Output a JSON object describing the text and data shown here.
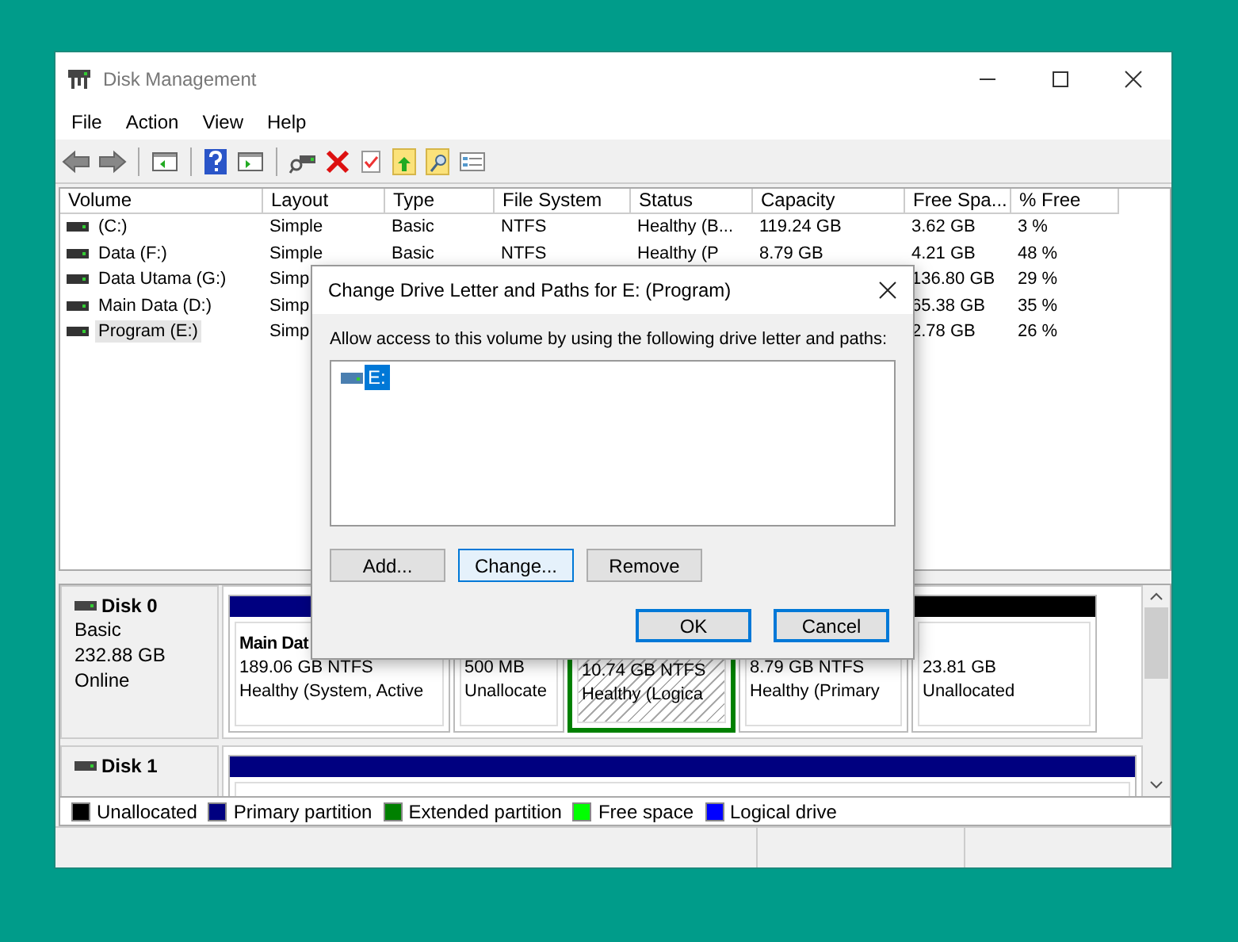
{
  "window": {
    "title": "Disk Management"
  },
  "menu": [
    "File",
    "Action",
    "View",
    "Help"
  ],
  "volume_table": {
    "columns": [
      "Volume",
      "Layout",
      "Type",
      "File System",
      "Status",
      "Capacity",
      "Free Spa...",
      "% Free"
    ],
    "rows": [
      {
        "selected": false,
        "cells": [
          " (C:)",
          "Simple",
          "Basic",
          "NTFS",
          "Healthy (B...",
          "119.24 GB",
          "3.62 GB",
          "3 %"
        ]
      },
      {
        "selected": false,
        "cells": [
          "Data (F:)",
          "Simple",
          "Basic",
          "NTFS",
          "Healthy (P",
          "8.79 GB",
          "4.21 GB",
          "48 %"
        ]
      },
      {
        "selected": false,
        "cells": [
          "Data Utama (G:)",
          "Simp",
          "",
          "",
          "",
          "",
          "136.80 GB",
          "29 %"
        ]
      },
      {
        "selected": false,
        "cells": [
          "Main Data (D:)",
          "Simp",
          "",
          "",
          "",
          "",
          "65.38 GB",
          "35 %"
        ]
      },
      {
        "selected": true,
        "cells": [
          "Program (E:)",
          "Simp",
          "",
          "",
          "",
          "",
          "2.78 GB",
          "26 %"
        ]
      }
    ]
  },
  "disks": [
    {
      "name": "Disk 0",
      "lines": [
        "Basic",
        "232.88 GB",
        "Online"
      ],
      "partitions": [
        {
          "kind": "primary",
          "name": "Main Dat",
          "size": "189.06 GB NTFS",
          "status": "Healthy (System, Active"
        },
        {
          "kind": "unallocated",
          "size": "500 MB",
          "status": "Unallocate"
        },
        {
          "kind": "logical",
          "size": "10.74 GB NTFS",
          "status": "Healthy (Logica"
        },
        {
          "kind": "primary",
          "size": "8.79 GB NTFS",
          "status": "Healthy (Primary"
        },
        {
          "kind": "unallocated",
          "size": "23.81 GB",
          "status": "Unallocated"
        }
      ]
    },
    {
      "name": "Disk 1",
      "partitions": [
        {
          "kind": "primary"
        }
      ]
    }
  ],
  "legend": [
    {
      "label": "Unallocated",
      "color": "#000000"
    },
    {
      "label": "Primary partition",
      "color": "#000080"
    },
    {
      "label": "Extended partition",
      "color": "#008000"
    },
    {
      "label": "Free space",
      "color": "#00ff00"
    },
    {
      "label": "Logical drive",
      "color": "#0000ff"
    }
  ],
  "dialog": {
    "title": "Change Drive Letter and Paths for E: (Program)",
    "prompt": "Allow access to this volume by using the following drive letter and paths:",
    "paths": [
      {
        "label": "E:",
        "selected": true
      }
    ],
    "buttons": [
      {
        "label": "Add...",
        "kind": "plain"
      },
      {
        "label": "Change...",
        "kind": "focused"
      },
      {
        "label": "Remove",
        "kind": "plain"
      }
    ],
    "footer_buttons": [
      {
        "label": "OK",
        "kind": "default"
      },
      {
        "label": "Cancel",
        "kind": "default"
      }
    ]
  }
}
